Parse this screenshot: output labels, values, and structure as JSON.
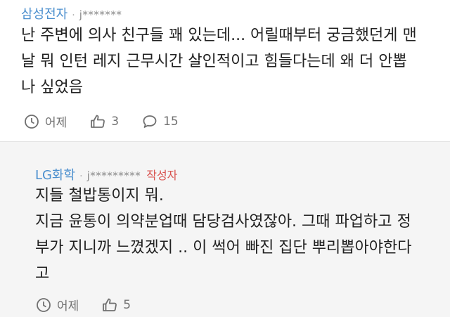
{
  "comment": {
    "author": "삼성전자",
    "user_id": "j*******",
    "lines": [
      "난 주변에 의사 친구들 꽤 있는데... 어릴때부터 궁금했던게 맨",
      "날 뭐 인턴 레지 근무시간 살인적이고 힘들다는데 왜 더 안뽑",
      "나 싶었음"
    ],
    "time": "어제",
    "likes": "3",
    "replies": "15"
  },
  "reply": {
    "author": "LG화학",
    "user_id": "j*********",
    "author_badge": "작성자",
    "lines": [
      "지들 철밥통이지 뭐.",
      "지금 윤통이 의약분업때 담당검사였잖아. 그때 파업하고 정",
      "부가 지니까 느꼈겠지 .. 이 썩어 빠진 집단 뿌리뽑아야한다",
      "고"
    ],
    "time": "어제",
    "likes": "5"
  },
  "colors": {
    "author": "#4b8fce",
    "badge": "#d9534f",
    "reply_bg": "#f5f5f5",
    "icon": "#707070"
  },
  "icons": [
    "clock-icon",
    "thumbs-up-icon",
    "comment-icon"
  ]
}
